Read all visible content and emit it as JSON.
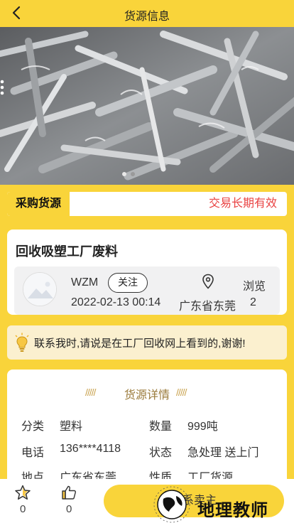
{
  "header": {
    "title": "货源信息",
    "back_icon": "chevron-left-icon"
  },
  "banner": {
    "more_icon": "vertical-dots-icon",
    "carousel_dots": 3
  },
  "purchase": {
    "tag": "采购货源",
    "validity": "交易长期有效"
  },
  "product": {
    "title": "回收吸塑工厂废料",
    "seller": {
      "name": "WZM",
      "follow_label": "关注",
      "date": "2022-02-13 00:14",
      "location": "广东省东莞",
      "browse_label": "浏览",
      "views": "2"
    }
  },
  "notice": {
    "text": "联系我时,请说是在工厂回收网上看到的,谢谢!"
  },
  "detail": {
    "section_title": "货源详情",
    "rows": [
      {
        "label": "分类",
        "value": "塑料"
      },
      {
        "label": "数量",
        "value": "999吨"
      },
      {
        "label": "电话",
        "value": "136****4118"
      },
      {
        "label": "状态",
        "value": "急处理 送上门"
      },
      {
        "label": "地点",
        "value": "广东省东莞"
      },
      {
        "label": "性质",
        "value": "工厂货源"
      }
    ]
  },
  "bottom": {
    "fav_count": "0",
    "like_count": "0",
    "contact_label": "联系卖主"
  },
  "watermark": {
    "text": "地理教师"
  },
  "colors": {
    "accent": "#f9d43a",
    "red": "#e94343",
    "notice_bg": "#fbf0cf"
  }
}
